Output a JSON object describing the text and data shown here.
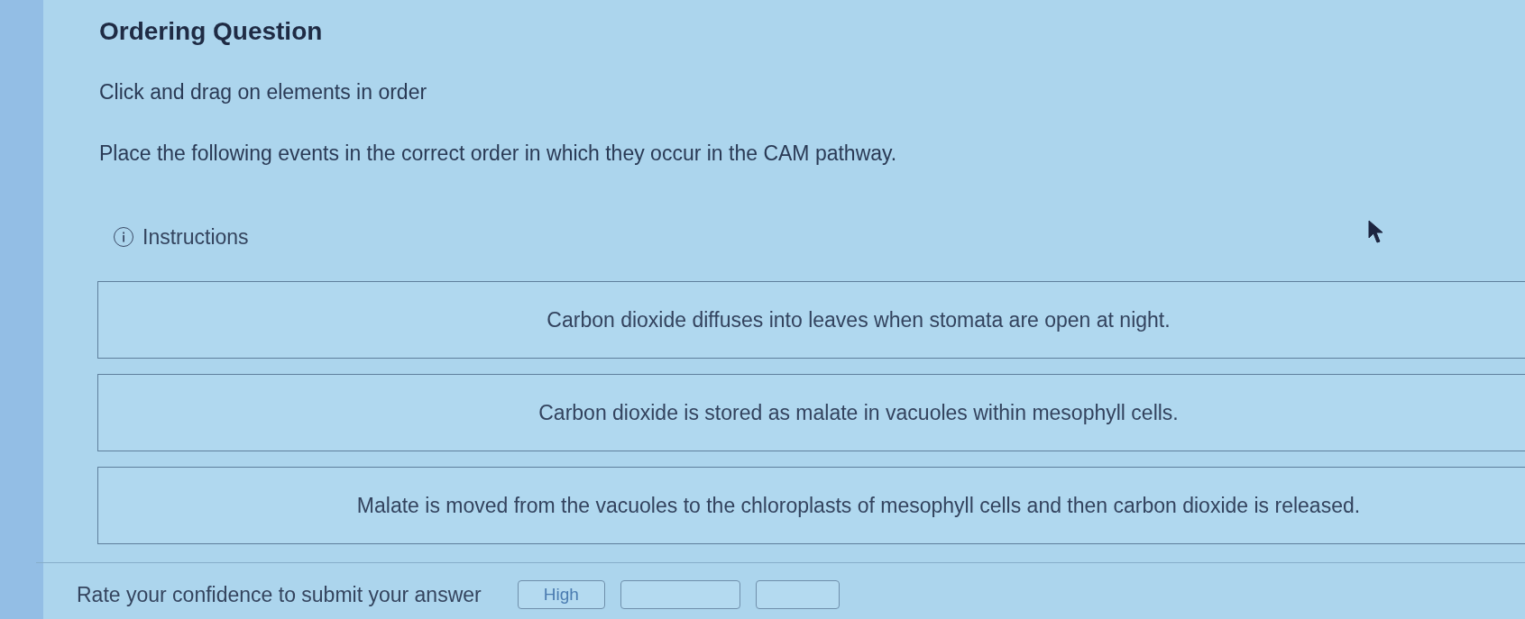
{
  "title": "Ordering Question",
  "instruction": "Click and drag on elements in order",
  "question": "Place the following events in the correct order in which they occur in the CAM pathway.",
  "instructions_toggle": {
    "label": "Instructions"
  },
  "items": [
    "Carbon dioxide diffuses into leaves when stomata are open at night.",
    "Carbon dioxide is stored as malate in vacuoles within mesophyll cells.",
    "Malate is moved from the vacuoles to the chloroplasts of mesophyll cells and then carbon dioxide is released."
  ],
  "confidence": {
    "prompt": "Rate your confidence to submit your answer",
    "buttons": [
      {
        "kind": "labeled",
        "label": "High"
      },
      {
        "kind": "blank"
      },
      {
        "kind": "blank"
      }
    ]
  }
}
